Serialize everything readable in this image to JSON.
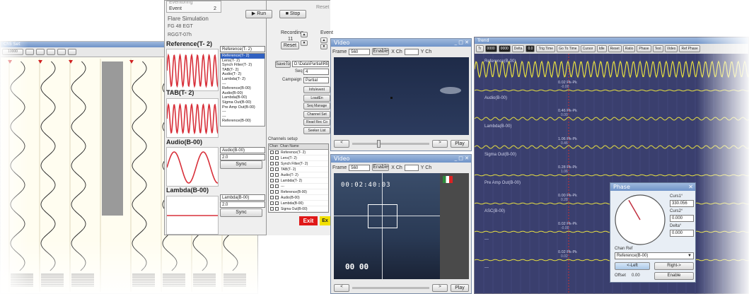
{
  "windows": {
    "event_panel": {
      "title": "Eventoring",
      "event_label": "Event",
      "event_value": "2",
      "flare_label": "Flare Simulation",
      "fg_label": "FG 48 EGT",
      "rggt_label": "RGGT-07h"
    },
    "scope_panel": {
      "reference_title": "Reference(T- 2)",
      "tab_title": "TAB(T- 2)",
      "audio_title": "Audio(B-00)",
      "lambda_title": "Lambda(B-00)",
      "ref_select": "Reference(T- 2)",
      "audio_select": "Audio(B-00)",
      "lambda_select": "Lambda(B-00)",
      "range_value_1": "2.0",
      "range_value_2": "2.0",
      "sync_label": "Sync",
      "sync_label_2": "Sync"
    },
    "control_panel": {
      "run_label": "Run",
      "stop_label": "Stop",
      "reset_label": "Reset",
      "recording_label": "Recording",
      "recording_value": "11",
      "reset_label_2": "Reset",
      "event_label": "Event",
      "save_label": "SaveTo",
      "save_path": "D:\\Data\\Partial\\REG",
      "seq_label": "Seq",
      "seq_value": "4",
      "campaign_label": "Campaign",
      "campaign_value": "Partial",
      "channel_list": [
        "Reference(T- 2)",
        "Lens(T- 2)",
        "Synch Filter(T- 2)",
        "TAB(T- 2)",
        "Audio(T- 2)",
        "Lambda(T- 2)",
        "---",
        "Reference(B-00)",
        "Audio(B-00)",
        "Lambda(B-00)",
        "Sigma Out(B-00)",
        "Pre Amp Out(B-00)",
        "---",
        "---",
        "Reference(B-00)"
      ],
      "side_buttons": [
        "Info/event",
        "LoadEn",
        "Seq Manage",
        "Channel Set",
        "Read Rec Co",
        "Seeker List"
      ],
      "channels_setup_label": "Channels setup",
      "chan_col": "Chan",
      "chan_name_col": "Chan Name",
      "channel_rows": [
        "Reference(T- 2)",
        "Lens(T- 2)",
        "Synch Filter(T- 2)",
        "TAB(T- 2)",
        "Audio(T- 2)",
        "Lambda(T- 2)",
        "---",
        "Reference(B-00)",
        "Audio(B-00)",
        "Lambda(B-00)",
        "Sigma Out(B-00)"
      ],
      "exit_label": "Exit",
      "extra_label": "Ex"
    },
    "video_top": {
      "title": "Video",
      "frame_label": "Frame",
      "frame_value": "560",
      "enable_label": "Enable",
      "x_label": "X Ch",
      "y_label": "Y Ch",
      "play_label": "Play"
    },
    "video_bottom": {
      "title": "Video",
      "frame_label": "Frame",
      "frame_value": "560",
      "enable_label": "Enable",
      "x_label": "X Ch",
      "y_label": "Y Ch",
      "timecode": "00:02:40:03",
      "overlay_code": "00 00",
      "play_label": "Play"
    },
    "trend": {
      "title": "Trend",
      "toolbar": [
        "Tr",
        "0000",
        "0000",
        "Delta",
        "0.0",
        "Trig Time",
        "Go To Time",
        "Cursor",
        "Idle",
        "Reset",
        "Ratio",
        "Phase",
        "Text",
        "Video",
        "Ref Phase"
      ],
      "channels": [
        {
          "name": "Reference(B-00)",
          "value": ""
        },
        {
          "name": "Audio(B-00)",
          "value": "0.02 Pk-Pk"
        },
        {
          "name": "Lambda(B-00)",
          "value": "0.46 Pk-Pk"
        },
        {
          "name": "Sigma Out(B-00)",
          "value": "1.06 Pk-Pk"
        },
        {
          "name": "Pre Amp Out(B-00)",
          "value": "0.28 Pk-Pk"
        },
        {
          "name": "ASC(B-00)",
          "value": "0.00 Pk-Pk"
        },
        {
          "name": "---",
          "value": "0.02 Pk-Pk"
        },
        {
          "name": "---",
          "value": "0.02 Pk-Pk"
        }
      ],
      "axis_values": [
        "-0.00",
        "0.00",
        "0.46",
        "1.06",
        "0.28",
        "-0.00",
        "0.02"
      ]
    },
    "phase": {
      "title": "Phase",
      "curs1_label": "Curs1°",
      "curs1_value": "330.056",
      "curs2_label": "Curs2°",
      "curs2_value": "0.000",
      "delta_label": "Delta°",
      "delta_value": "0.000",
      "chan_ref_label": "Chan Ref",
      "chan_ref_value": "Reference(B-00)",
      "left_btn": "<-Left",
      "right_btn": "Right->",
      "offset_label": "Offset",
      "offset_value": "0.00",
      "enable_btn": "Enable"
    },
    "back_scope": {
      "title": "Ch5 Set",
      "toolbar": [
        "10000"
      ]
    }
  },
  "colors": {
    "reference_wave": "#d8303a",
    "trend_bg": "#3a3f6e",
    "trend_wave": "#e8e040",
    "video_sky": "#1c2a45",
    "exit_button": "#e01818",
    "ex_button": "#f2e000"
  }
}
